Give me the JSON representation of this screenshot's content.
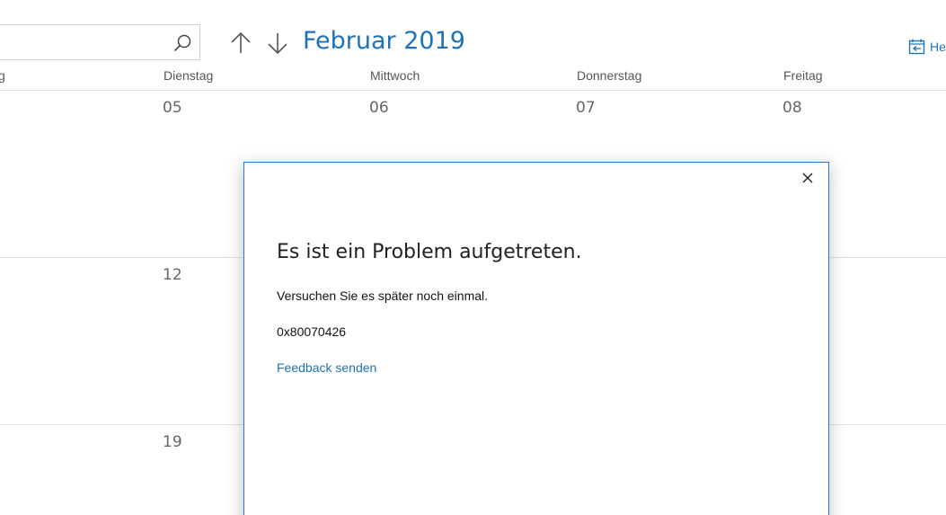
{
  "header": {
    "month_title": "Februar 2019",
    "today_label": "He"
  },
  "day_headers": [
    "g",
    "Dienstag",
    "Mittwoch",
    "Donnerstag",
    "Freitag"
  ],
  "weeks": [
    [
      "05",
      "06",
      "07",
      "08"
    ],
    [
      "12"
    ],
    [
      "19"
    ]
  ],
  "dialog": {
    "title": "Es ist ein Problem aufgetreten.",
    "message": "Versuchen Sie es später noch einmal.",
    "error_code": "0x80070426",
    "feedback_link": "Feedback senden"
  },
  "colors": {
    "accent": "#1e73b8",
    "dialog_border": "#2b78c5",
    "grid_line": "#e1e1e1"
  },
  "icons": {
    "search": "search-icon",
    "up": "arrow-up-icon",
    "down": "arrow-down-icon",
    "today": "calendar-today-icon",
    "close": "close-icon"
  }
}
